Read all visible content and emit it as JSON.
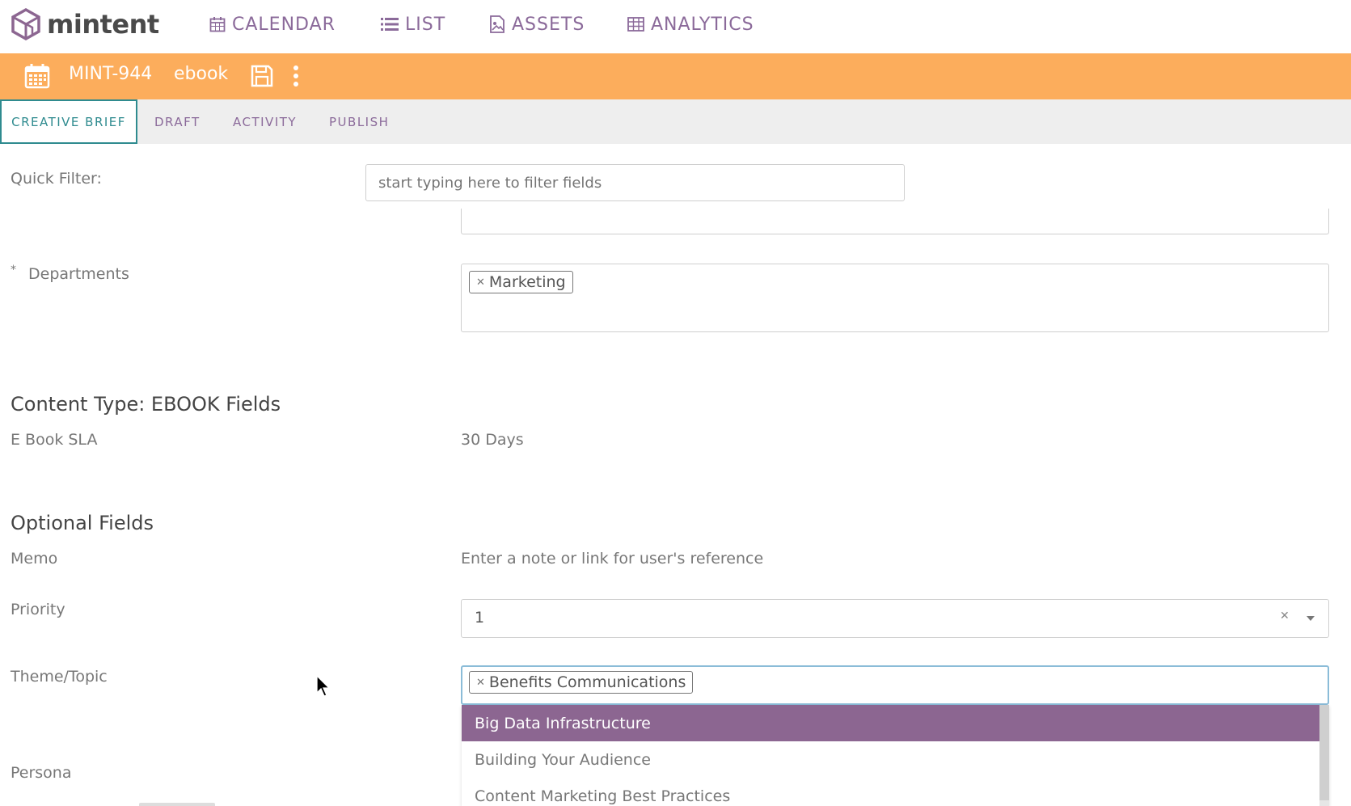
{
  "app": {
    "name": "mintent"
  },
  "nav": [
    {
      "label": "CALENDAR",
      "icon": "calendar-icon"
    },
    {
      "label": "LIST",
      "icon": "list-icon"
    },
    {
      "label": "ASSETS",
      "icon": "image-icon"
    },
    {
      "label": "ANALYTICS",
      "icon": "table-icon"
    }
  ],
  "item": {
    "id": "MINT-944",
    "type": "ebook"
  },
  "tabs": [
    {
      "label": "CREATIVE BRIEF",
      "active": true
    },
    {
      "label": "DRAFT"
    },
    {
      "label": "ACTIVITY"
    },
    {
      "label": "PUBLISH"
    }
  ],
  "quick_filter": {
    "label": "Quick Filter:",
    "placeholder": "start typing here to filter fields"
  },
  "departments": {
    "required_mark": "*",
    "label": "Departments",
    "tags": [
      "Marketing"
    ]
  },
  "content_type": {
    "title": "Content Type: EBOOK Fields",
    "sla_label": "E Book SLA",
    "sla_value": "30 Days"
  },
  "optional": {
    "title": "Optional Fields",
    "memo_label": "Memo",
    "memo_placeholder": "Enter a note or link for user's reference",
    "priority_label": "Priority",
    "priority_value": "1",
    "theme_label": "Theme/Topic",
    "theme_tags": [
      "Benefits Communications"
    ],
    "persona_label": "Persona"
  },
  "theme_dropdown": {
    "options": [
      "Big Data Infrastructure",
      "Building Your Audience",
      "Content Marketing Best Practices"
    ],
    "highlighted": 0
  },
  "colors": {
    "orange": "#fcad5c",
    "purple": "#8c6691",
    "teal": "#2f8b8f"
  }
}
